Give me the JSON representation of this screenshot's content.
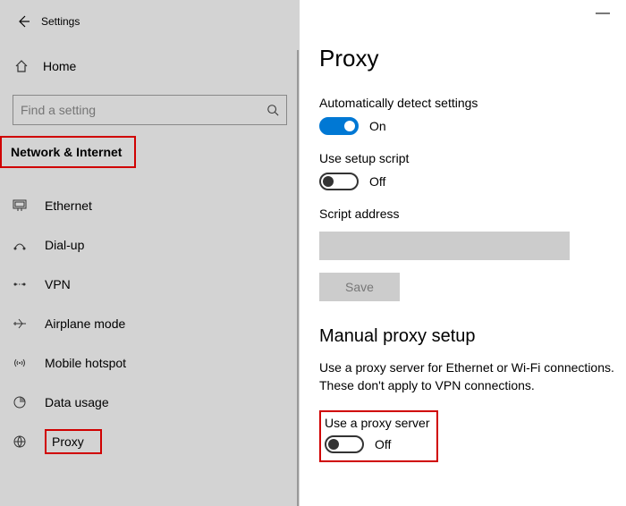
{
  "titlebar": {
    "title": "Settings"
  },
  "home": {
    "label": "Home"
  },
  "search": {
    "placeholder": "Find a setting"
  },
  "category": {
    "label": "Network & Internet"
  },
  "nav": {
    "ethernet": "Ethernet",
    "dialup": "Dial-up",
    "vpn": "VPN",
    "airplane": "Airplane mode",
    "hotspot": "Mobile hotspot",
    "datausage": "Data usage",
    "proxy": "Proxy"
  },
  "page": {
    "title": "Proxy",
    "auto_detect_label": "Automatically detect settings",
    "auto_detect_state": "On",
    "setup_script_label": "Use setup script",
    "setup_script_state": "Off",
    "script_address_label": "Script address",
    "save_label": "Save",
    "manual_heading": "Manual proxy setup",
    "manual_desc": "Use a proxy server for Ethernet or Wi-Fi connections. These don't apply to VPN connections.",
    "use_proxy_label": "Use a proxy server",
    "use_proxy_state": "Off"
  }
}
